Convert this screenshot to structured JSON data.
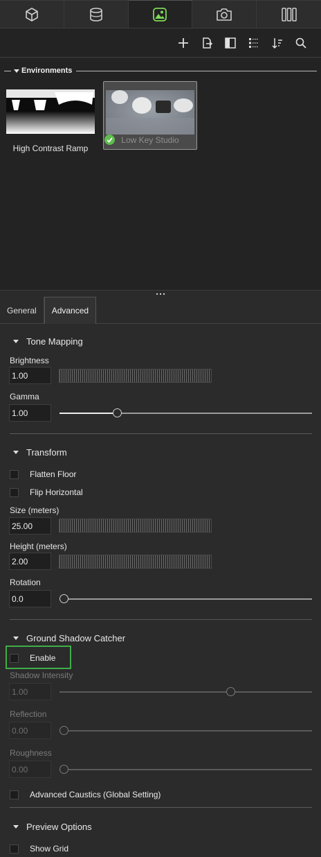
{
  "top_tabs": [
    {
      "icon": "cube-icon",
      "active": false
    },
    {
      "icon": "cylinder-icon",
      "active": false
    },
    {
      "icon": "environment-icon",
      "active": true
    },
    {
      "icon": "camera-icon",
      "active": false
    },
    {
      "icon": "library-icon",
      "active": false
    }
  ],
  "toolbar_icons": [
    "add-icon",
    "import-icon",
    "panel-icon",
    "grid-view-icon",
    "sort-icon",
    "search-icon"
  ],
  "library": {
    "section_title": "Environments",
    "items": [
      {
        "label": "High Contrast Ramp",
        "selected": false
      },
      {
        "label": "Low Key Studio",
        "selected": true
      }
    ]
  },
  "subtabs": [
    {
      "label": "General",
      "active": false
    },
    {
      "label": "Advanced",
      "active": true
    }
  ],
  "tone_mapping": {
    "title": "Tone Mapping",
    "brightness_label": "Brightness",
    "brightness_value": "1.00",
    "gamma_label": "Gamma",
    "gamma_value": "1.00",
    "gamma_slider": 0.21
  },
  "transform": {
    "title": "Transform",
    "flatten_floor_label": "Flatten Floor",
    "flatten_floor_checked": false,
    "flip_horizontal_label": "Flip Horizontal",
    "flip_horizontal_checked": false,
    "size_label": "Size (meters)",
    "size_value": "25.00",
    "height_label": "Height (meters)",
    "height_value": "2.00",
    "rotation_label": "Rotation",
    "rotation_value": "0.0",
    "rotation_slider": 0.0
  },
  "ground_shadow": {
    "title": "Ground Shadow Catcher",
    "enable_label": "Enable",
    "enable_checked": false,
    "intensity_label": "Shadow Intensity",
    "intensity_value": "1.00",
    "intensity_slider": 0.66,
    "reflection_label": "Reflection",
    "reflection_value": "0.00",
    "reflection_slider": 0.0,
    "roughness_label": "Roughness",
    "roughness_value": "0.00",
    "roughness_slider": 0.0,
    "caustics_label": "Advanced Caustics (Global Setting)",
    "caustics_checked": false
  },
  "preview_options": {
    "title": "Preview Options",
    "show_grid_label": "Show Grid",
    "show_grid_checked": false
  },
  "colors": {
    "accent_green": "#5fbe4d",
    "highlight_green": "#3fae49"
  }
}
